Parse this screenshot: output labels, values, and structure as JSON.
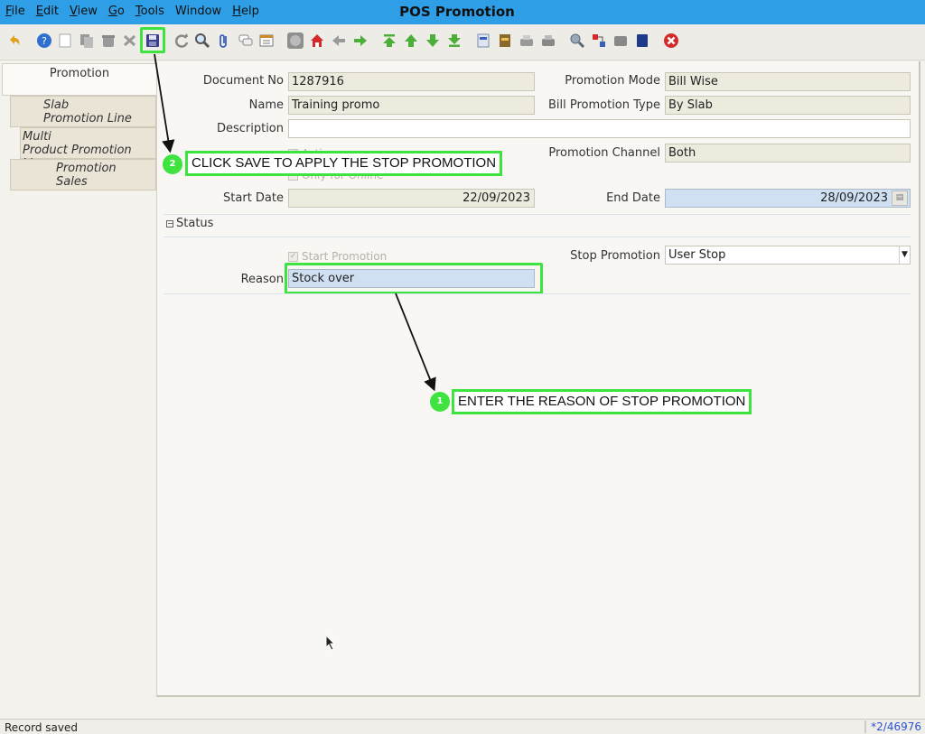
{
  "window": {
    "title": "POS Promotion"
  },
  "menu": [
    "File",
    "Edit",
    "View",
    "Go",
    "Tools",
    "Window",
    "Help"
  ],
  "tabs": [
    {
      "line1": "Promotion",
      "line2": ""
    },
    {
      "line1": "Slab",
      "line2": "Promotion Line"
    },
    {
      "line1": "Multi",
      "line2": "Product Promotion Line"
    },
    {
      "line1": "Promotion",
      "line2": "Sales"
    }
  ],
  "form": {
    "document_no_label": "Document No",
    "document_no": "1287916",
    "name_label": "Name",
    "name": "Training promo",
    "description_label": "Description",
    "description": "",
    "active_label": "Active",
    "only_online_label": "Only for Online",
    "promotion_mode_label": "Promotion Mode",
    "promotion_mode": "Bill Wise",
    "bill_promotion_type_label": "Bill Promotion Type",
    "bill_promotion_type": "By Slab",
    "promotion_channel_label": "Promotion Channel",
    "promotion_channel": "Both",
    "start_date_label": "Start Date",
    "start_date": "22/09/2023",
    "end_date_label": "End Date",
    "end_date": "28/09/2023",
    "status_section": "Status",
    "start_promotion_label": "Start Promotion",
    "stop_promotion_label": "Stop Promotion",
    "stop_promotion": "User Stop",
    "reason_label": "Reason",
    "reason": "Stock over"
  },
  "callouts": [
    {
      "number": "2",
      "text": "CLICK SAVE TO APPLY THE STOP PROMOTION"
    },
    {
      "number": "1",
      "text": "ENTER THE REASON OF STOP PROMOTION"
    }
  ],
  "status": {
    "message": "Record saved",
    "record": "*2/46976"
  },
  "colors": {
    "accent": "#2e9ee6",
    "highlight": "#3fe33f",
    "field_blue": "#cfe0f3"
  }
}
